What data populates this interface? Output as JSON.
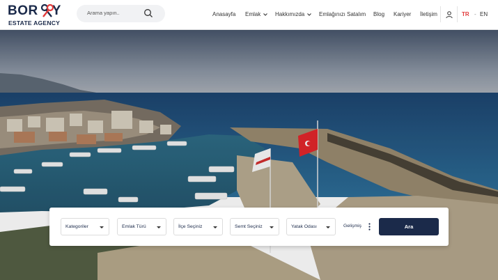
{
  "brand": {
    "name_part1": "BOR",
    "name_part2": "Y",
    "subtitle": "ESTATE AGENCY"
  },
  "search": {
    "placeholder": "Arama yapın.."
  },
  "nav": {
    "items": [
      {
        "label": "Anasayfa"
      },
      {
        "label": "Emlak"
      },
      {
        "label": "Hakkımızda"
      },
      {
        "label": "Emlağınızı Satalım"
      },
      {
        "label": "Blog"
      },
      {
        "label": "Kariyer"
      },
      {
        "label": "İletişim"
      }
    ]
  },
  "language": {
    "active": "TR",
    "separator": "-",
    "other": "EN"
  },
  "colors": {
    "brand": "#1b2a4a",
    "accent": "#e23b3b"
  },
  "property_search": {
    "filters": [
      {
        "label": "Kategoriler"
      },
      {
        "label": "Emlak Türü"
      },
      {
        "label": "İlçe Seçiniz"
      },
      {
        "label": "Semt Seçiniz"
      },
      {
        "label": "Yatak Odası"
      }
    ],
    "advanced_label": "Gelişmiş",
    "submit_label": "Ara"
  }
}
